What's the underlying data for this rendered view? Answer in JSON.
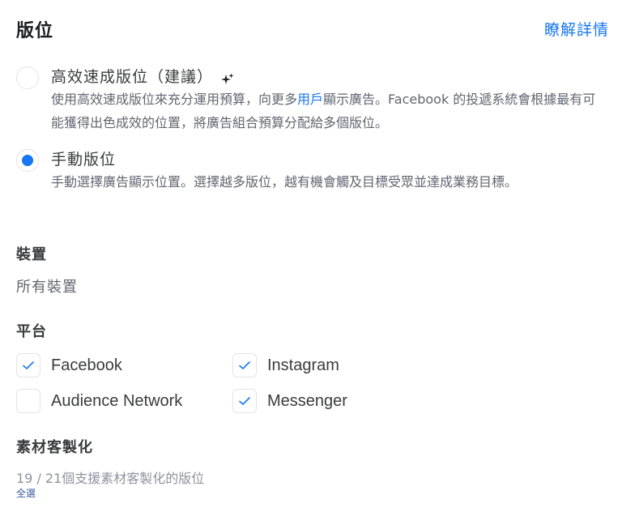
{
  "header": {
    "title": "版位",
    "learn_more": "瞭解詳情"
  },
  "placement_options": [
    {
      "label": "高效速成版位（建議）",
      "selected": false,
      "icon": "sparkle-icon",
      "description_before": "使用高效速成版位來充分運用預算，向更多",
      "description_link": "用戶",
      "description_after": "顯示廣告。Facebook 的投遞系統會根據最有可能獲得出色成效的位置，將廣告組合預算分配給多個版位。"
    },
    {
      "label": "手動版位",
      "selected": true,
      "description": "手動選擇廣告顯示位置。選擇越多版位，越有機會觸及目標受眾並達成業務目標。"
    }
  ],
  "devices": {
    "title": "裝置",
    "value": "所有裝置"
  },
  "platforms": {
    "title": "平台",
    "items": [
      {
        "label": "Facebook",
        "checked": true
      },
      {
        "label": "Instagram",
        "checked": true
      },
      {
        "label": "Audience Network",
        "checked": false
      },
      {
        "label": "Messenger",
        "checked": true
      }
    ]
  },
  "asset_customization": {
    "title": "素材客製化",
    "count_text": "19 / 21個支援素材客製化的版位",
    "select_all": "全選"
  },
  "colors": {
    "accent": "#1877f2",
    "text_primary": "#1c1e21",
    "text_secondary": "#606770",
    "border": "#e2e4e7"
  }
}
